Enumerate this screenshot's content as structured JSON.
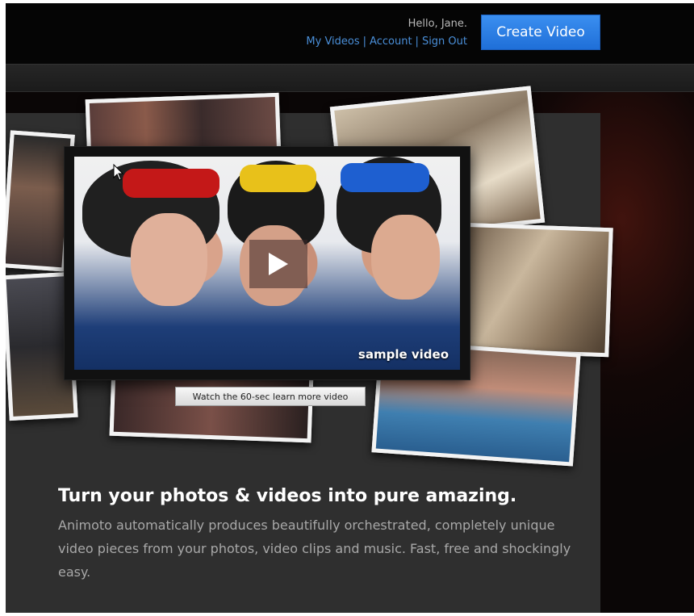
{
  "header": {
    "greeting": "Hello, Jane.",
    "links": [
      "My Videos",
      "Account",
      "Sign Out"
    ],
    "separator": "|",
    "cta_label": "Create Video"
  },
  "hero": {
    "video_label": "sample video",
    "learn_more_label": "Watch the 60-sec learn more video",
    "headline": "Turn your photos & videos into pure amazing.",
    "description": "Animoto automatically produces beautifully orchestrated, completely unique video pieces from your photos, video clips and music. Fast, free and shockingly easy."
  },
  "colors": {
    "accent": "#2a7fe6",
    "link": "#4a8fd9",
    "background": "#0a0606",
    "panel": "#2f2f2f"
  },
  "icons": [
    "play-icon",
    "mouse-cursor-icon"
  ]
}
